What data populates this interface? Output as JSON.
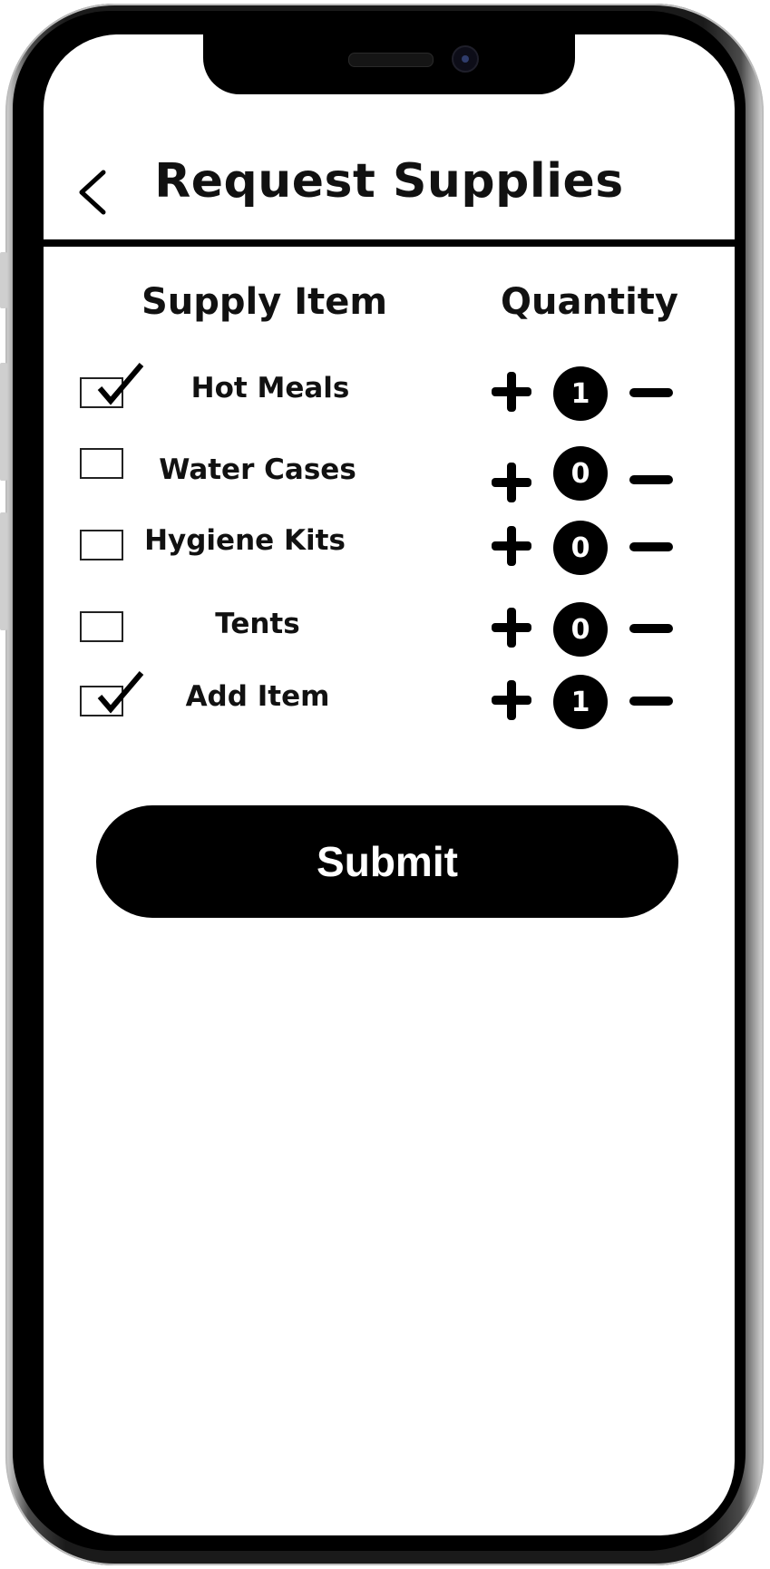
{
  "header": {
    "title": "Request Supplies",
    "back_icon": "chevron-left-icon"
  },
  "table": {
    "column_item": "Supply Item",
    "column_quantity": "Quantity",
    "rows": [
      {
        "label": "Hot Meals",
        "checked": true,
        "quantity": "1"
      },
      {
        "label": "Water Cases",
        "checked": false,
        "quantity": "0"
      },
      {
        "label": "Hygiene Kits",
        "checked": false,
        "quantity": "0"
      },
      {
        "label": "Tents",
        "checked": false,
        "quantity": "0"
      },
      {
        "label": "Add Item",
        "checked": true,
        "quantity": "1"
      }
    ]
  },
  "submit_label": "Submit",
  "colors": {
    "primary": "#000000",
    "background": "#ffffff"
  }
}
